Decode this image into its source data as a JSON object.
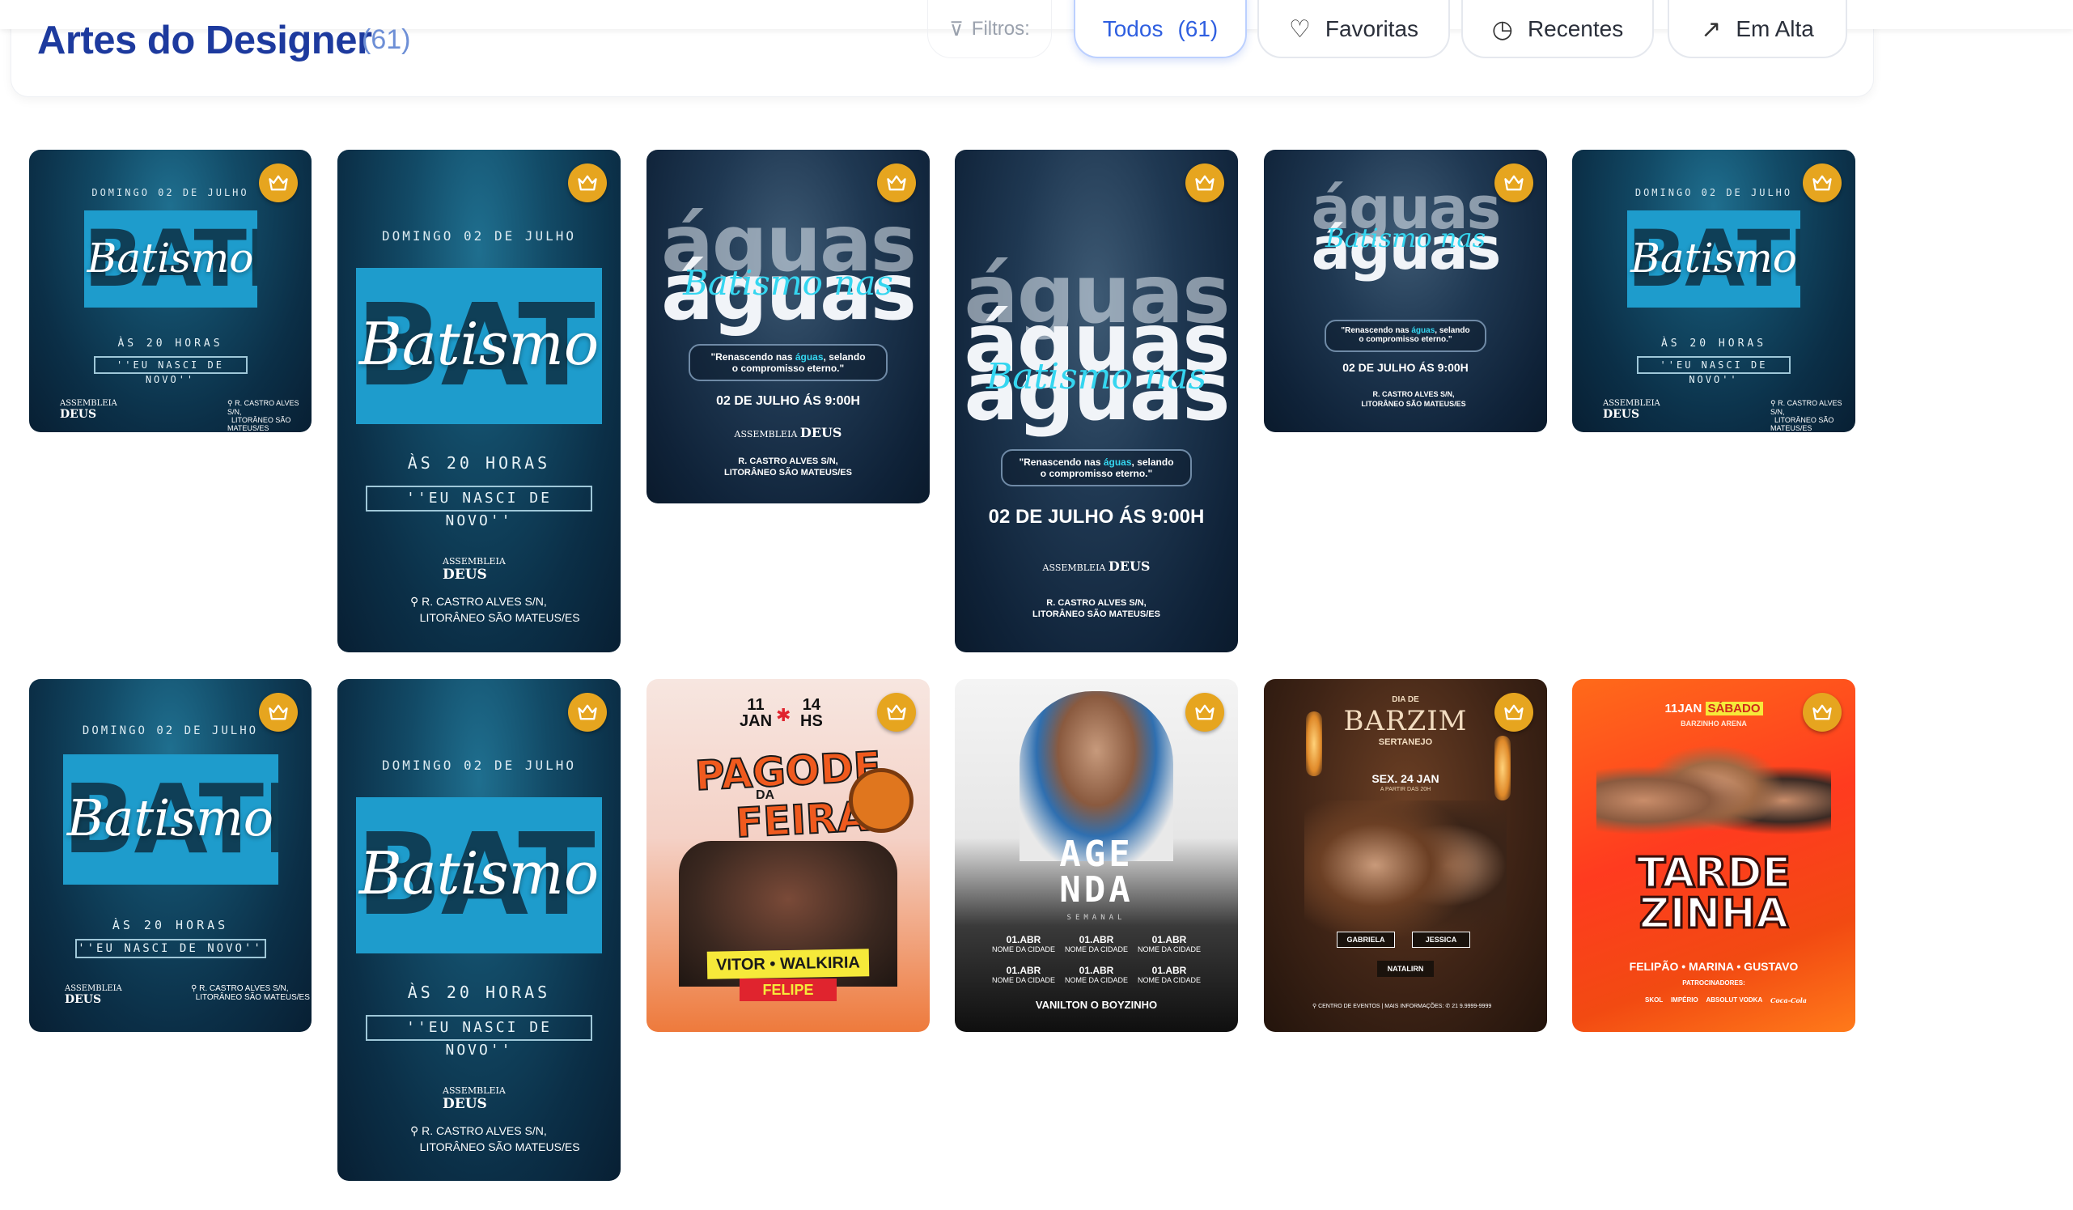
{
  "header": {
    "title": "Artes do Designer",
    "count": "(61)",
    "filters_label": "Filtros:",
    "pills": [
      {
        "label": "Todos",
        "count": "(61)",
        "icon": "none",
        "active": true
      },
      {
        "label": "Favoritas",
        "icon": "heart-icon",
        "active": false
      },
      {
        "label": "Recentes",
        "icon": "clock-icon",
        "active": false
      },
      {
        "label": "Em Alta",
        "icon": "trending-icon",
        "active": false
      }
    ]
  },
  "colors": {
    "title": "#1d3a9e",
    "accent": "#2f5fe0",
    "crown_badge": "#e6a51f"
  },
  "batismo": {
    "date": "DOMINGO 02 DE JULHO",
    "big": "BATISMO",
    "script": "Batismo",
    "hour": "ÀS 20 HORAS",
    "quote": "''EU NASCI DE NOVO''",
    "logo_top": "ASSEMBLEIA",
    "logo_main": "DEUS",
    "addr1": "R. CASTRO ALVES S/N,",
    "addr2": "LITORÂNEO SÃO MATEUS/ES"
  },
  "aguas": {
    "word": "águas",
    "script": "Batismo nas",
    "line1_pre": "\"Renascendo nas ",
    "line1_hl": "águas",
    "line1_post": ", selando",
    "line2": "o compromisso eterno.\"",
    "when": "02 DE JULHO ÁS 9:00H",
    "logo_top": "ASSEMBLEIA",
    "logo_main": "DEUS",
    "addr1": "R. CASTRO ALVES S/N,",
    "addr2": "LITORÂNEO SÃO MATEUS/ES"
  },
  "pagode": {
    "date_day": "11",
    "date_month": "JAN",
    "time": "14",
    "time_unit": "HS",
    "title1": "PAGODE",
    "title_da": "DA",
    "title2": "FEIRA",
    "names": "VITOR • WALKIRIA",
    "name3": "FELIPE"
  },
  "agenda": {
    "title1": "AGE",
    "title2": "NDA",
    "subtitle": "SEMANAL",
    "date": "01.ABR",
    "place": "NOME DA CIDADE",
    "artist": "VANILTON O BOYZINHO"
  },
  "barzim": {
    "pre": "DIA DE",
    "title": "BARZIM",
    "sub": "SERTANEJO",
    "date": "SEX. 24 JAN",
    "time": "A PARTIR DAS 20H",
    "name1": "GABRIELA",
    "name2": "JESSICA",
    "dj": "NATALIRN",
    "venue": "CENTRO DE EVENTOS",
    "info": "MAIS INFORMAÇÕES:",
    "phone": "21 9.9999-9999"
  },
  "tardezinha": {
    "date": "11JAN",
    "day": "SÁBADO",
    "venue": "BARZINHO ARENA",
    "title1": "TARDE",
    "title2": "ZINHA",
    "names": "FELIPÃO • MARINA • GUSTAVO",
    "sponsors_label": "PATROCINADORES:",
    "sponsors": [
      "SKOL",
      "IMPÉRIO",
      "ABSOLUT VODKA",
      "Coca-Cola"
    ]
  }
}
